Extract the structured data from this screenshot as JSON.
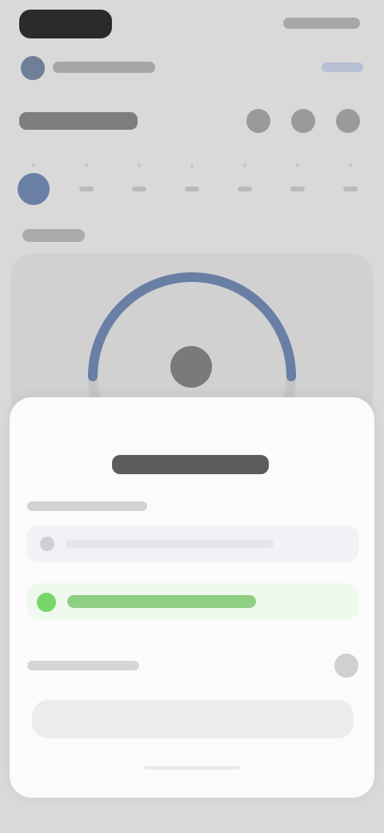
{
  "theme": {
    "accent": "#6a7fa5",
    "success": "#78d66b",
    "sheet_bg": "#fbfbfb"
  },
  "status_bar": {
    "time": "",
    "icons": [
      "signal-icon",
      "wifi-icon",
      "battery-icon"
    ]
  },
  "header": {
    "avatar_icon": "user-avatar-icon",
    "text": "",
    "action": ""
  },
  "title_row": {
    "title": "",
    "buttons": [
      "calendar-icon",
      "filter-icon",
      "more-icon"
    ]
  },
  "days": [
    {
      "label": "",
      "selected": true
    },
    {
      "label": "",
      "selected": false
    },
    {
      "label": "",
      "selected": false
    },
    {
      "label": "",
      "selected": false
    },
    {
      "label": "",
      "selected": false
    },
    {
      "label": "",
      "selected": false
    },
    {
      "label": "",
      "selected": false
    }
  ],
  "section": {
    "label": ""
  },
  "progress": {
    "value": 0.5
  },
  "sheet": {
    "title": "",
    "field_label": "",
    "list_item": "",
    "success_message": "",
    "toggle_label": "",
    "button_label": ""
  }
}
